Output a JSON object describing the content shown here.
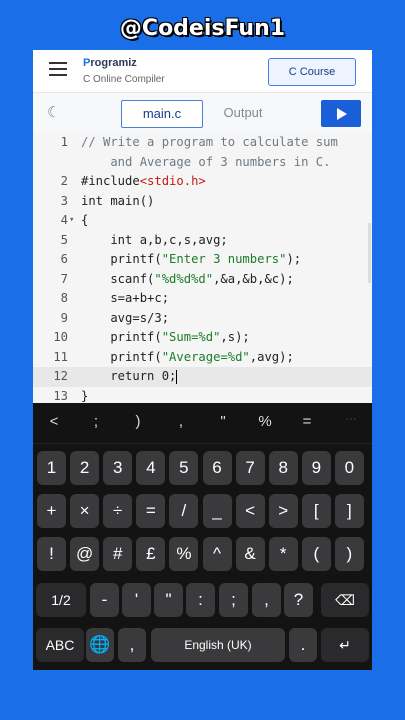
{
  "watermark": "@CodeisFun1",
  "header": {
    "logo_p": "P",
    "logo_rest": "rogramiz",
    "subtitle": "C Online Compiler",
    "course_button": "C Course"
  },
  "tabs": {
    "main": "main.c",
    "output": "Output"
  },
  "editor": {
    "lines": [
      {
        "n": "1",
        "fold": "",
        "html": "<span class='c-com'>// Write a program to calculate sum</span>"
      },
      {
        "n": "",
        "fold": "",
        "html": "<span class='c-com'>    and Average of 3 numbers in C.</span>"
      },
      {
        "n": "2",
        "fold": "",
        "html": "#include<span class='c-inc'>&lt;stdio.h&gt;</span>"
      },
      {
        "n": "3",
        "fold": "",
        "html": "int main()"
      },
      {
        "n": "4",
        "fold": "▾",
        "html": "{"
      },
      {
        "n": "5",
        "fold": "",
        "html": "    int a,b,c,s,avg;"
      },
      {
        "n": "6",
        "fold": "",
        "html": "    printf(<span class='c-str'>\"Enter 3 numbers\"</span>);"
      },
      {
        "n": "7",
        "fold": "",
        "html": "    scanf(<span class='c-str'>\"%d%d%d\"</span>,&amp;a,&amp;b,&amp;c);"
      },
      {
        "n": "8",
        "fold": "",
        "html": "    s=a+b+c;"
      },
      {
        "n": "9",
        "fold": "",
        "html": "    avg=s/3;"
      },
      {
        "n": "10",
        "fold": "",
        "html": "    printf(<span class='c-str'>\"Sum=%d\"</span>,s);"
      },
      {
        "n": "11",
        "fold": "",
        "html": "    printf(<span class='c-str'>\"Average=%d\"</span>,avg);"
      },
      {
        "n": "12",
        "fold": "",
        "html": "    return 0;<span class='cursor'></span>",
        "active": true
      },
      {
        "n": "13",
        "fold": "",
        "html": "}"
      }
    ]
  },
  "keyboard": {
    "symbols": [
      "<",
      ";",
      ")",
      ",",
      "\"",
      "%",
      "=",
      "···"
    ],
    "row1": [
      "1",
      "2",
      "3",
      "4",
      "5",
      "6",
      "7",
      "8",
      "9",
      "0"
    ],
    "row2": [
      "+",
      "×",
      "÷",
      "=",
      "/",
      "_",
      "<",
      ">",
      "[",
      "]"
    ],
    "row3": [
      "!",
      "@",
      "#",
      "£",
      "%",
      "^",
      "&",
      "*",
      "(",
      ")"
    ],
    "row4": [
      "1/2",
      "-",
      "'",
      "\"",
      ":",
      ";",
      ",",
      "?",
      "⌫"
    ],
    "row5": [
      "ABC",
      "🌐",
      ",",
      "English (UK)",
      ".",
      "↵"
    ]
  }
}
